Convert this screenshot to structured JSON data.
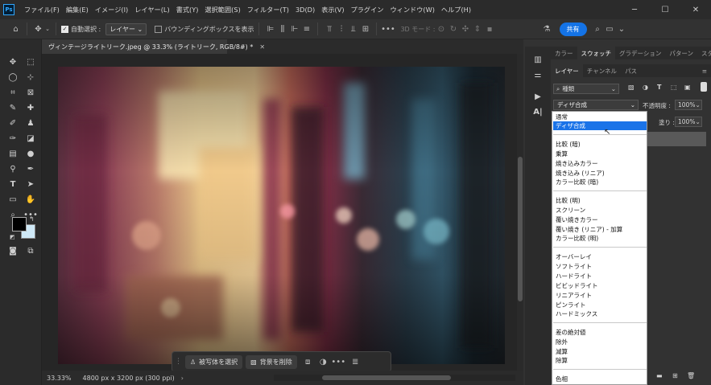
{
  "app": {
    "logo": "Ps"
  },
  "menu": [
    "ファイル(F)",
    "編集(E)",
    "イメージ(I)",
    "レイヤー(L)",
    "書式(Y)",
    "選択範囲(S)",
    "フィルター(T)",
    "3D(D)",
    "表示(V)",
    "プラグイン",
    "ウィンドウ(W)",
    "ヘルプ(H)"
  ],
  "window_controls": {
    "minimize": "─",
    "maximize": "☐",
    "close": "✕"
  },
  "options": {
    "auto_select_label": "自動選択 :",
    "auto_select_value": "レイヤー",
    "bounding_box_label": "バウンディングボックスを表示",
    "mode_3d": "3D モード :",
    "share": "共有"
  },
  "document": {
    "tab_title": "ヴィンテージライトリーク.jpeg @ 33.3% (ライトリーク, RGB/8#) *",
    "zoom": "33.33%",
    "doc_size": "4800 px x 3200 px (300 ppi)"
  },
  "context_bar": {
    "select_subject": "被写体を選択",
    "remove_bg": "背景を削除",
    "more": "•••"
  },
  "panels": {
    "tabs_top": [
      "カラー",
      "スウォッチ",
      "グラデーション",
      "パターン",
      "スタイル"
    ],
    "tabs_layers": [
      "レイヤー",
      "チャンネル",
      "パス"
    ],
    "filter_kind": "種類",
    "blend_mode": "ディザ合成",
    "opacity_label": "不透明度 :",
    "opacity_value": "100%",
    "fill_label": "塗り :",
    "fill_value": "100%"
  },
  "blend_modes": {
    "group1": [
      "通常",
      "ディザ合成"
    ],
    "group2": [
      "比較 (暗)",
      "乗算",
      "焼き込みカラー",
      "焼き込み (リニア)",
      "カラー比較 (暗)"
    ],
    "group3": [
      "比較 (明)",
      "スクリーン",
      "覆い焼きカラー",
      "覆い焼き (リニア) - 加算",
      "カラー比較 (明)"
    ],
    "group4": [
      "オーバーレイ",
      "ソフトライト",
      "ハードライト",
      "ビビッドライト",
      "リニアライト",
      "ピンライト",
      "ハードミックス"
    ],
    "group5": [
      "差の絶対値",
      "除外",
      "減算",
      "除算"
    ],
    "group6": [
      "色相"
    ],
    "selected": "ディザ合成"
  },
  "colors": {
    "accent": "#1473e6",
    "foreground": "#000000",
    "background": "#cfe9f7"
  }
}
